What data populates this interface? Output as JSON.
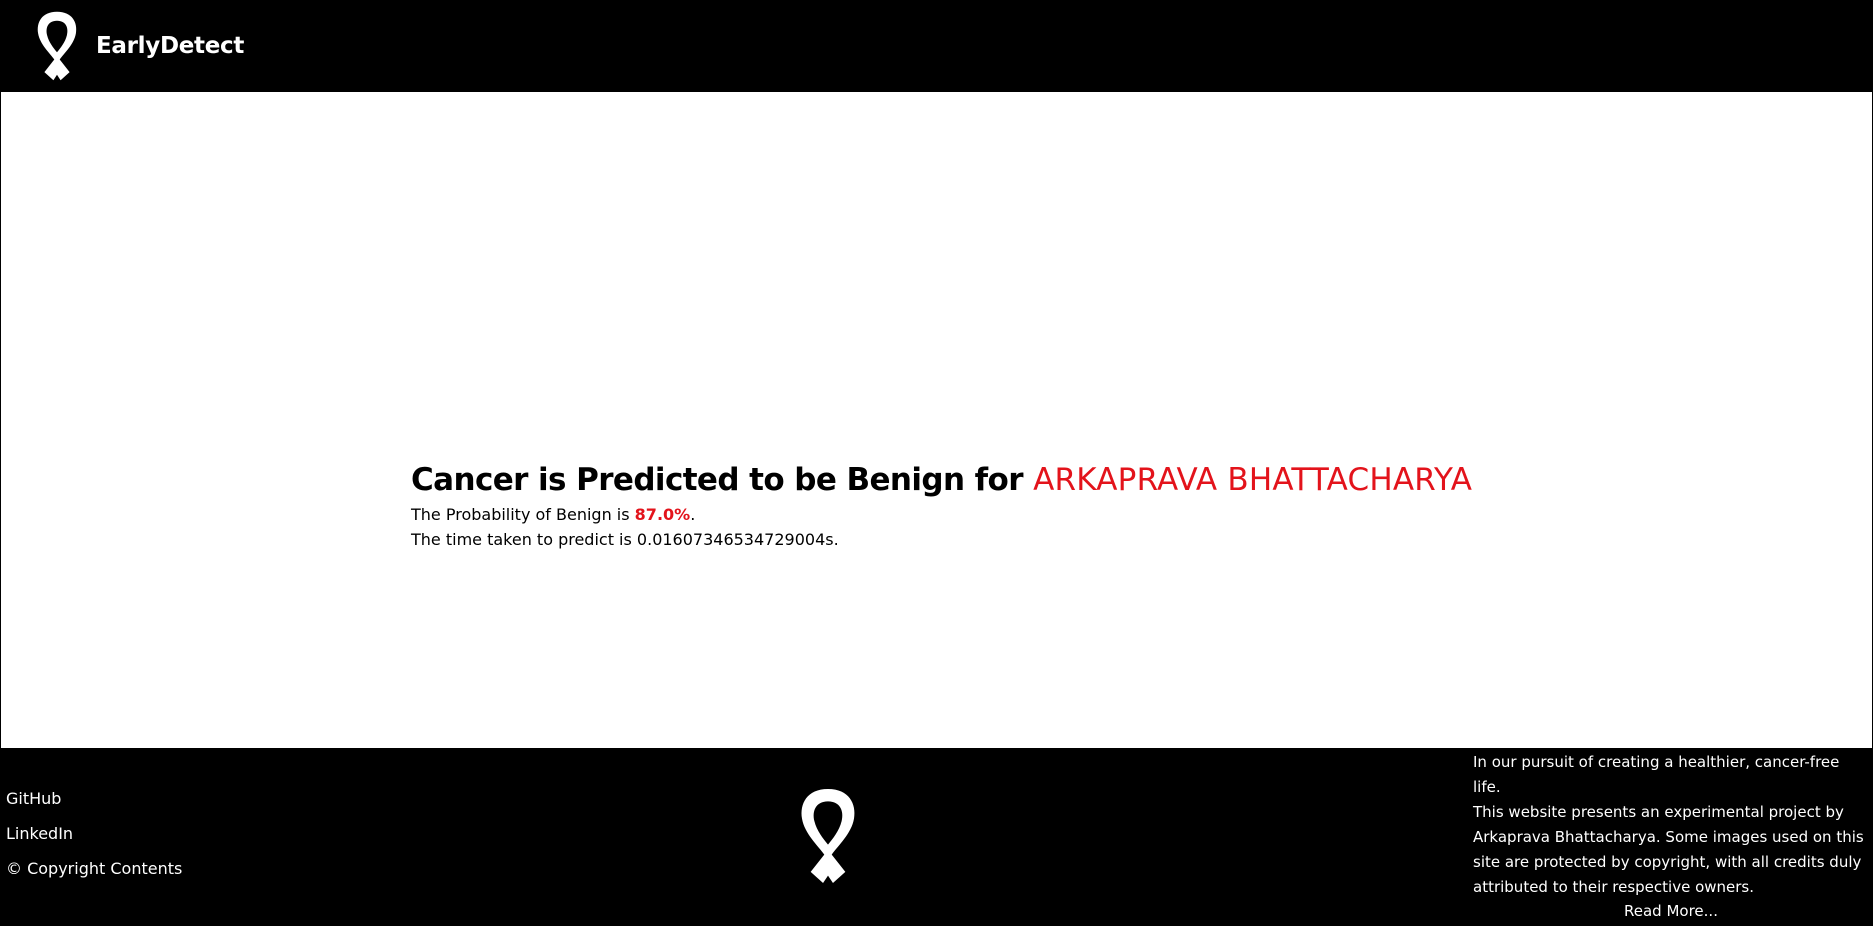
{
  "header": {
    "brand_name": "EarlyDetect",
    "logo_icon": "awareness-ribbon-icon"
  },
  "result": {
    "title_prefix": "Cancer is Predicted to be Benign for ",
    "patient_name": "ARKAPRAVA BHATTACHARYA",
    "probability_prefix": "The Probability of Benign is ",
    "probability_value": "87.0%",
    "probability_suffix": ".",
    "time_text": "The time taken to predict is 0.01607346534729004s."
  },
  "footer": {
    "links": {
      "github": "GitHub",
      "linkedin": "LinkedIn",
      "copyright": "© Copyright Contents"
    },
    "logo_icon": "awareness-ribbon-icon",
    "about_line1": "In our pursuit of creating a healthier, cancer-free life.",
    "about_line2": "This website presents an experimental project by Arkaprava Bhattacharya. Some images used on this site are protected by copyright, with all credits duly attributed to their respective owners.",
    "read_more": "Read More..."
  },
  "colors": {
    "header_bg": "#000000",
    "footer_bg": "#000000",
    "accent_red": "#e3131b",
    "text": "#000000"
  }
}
